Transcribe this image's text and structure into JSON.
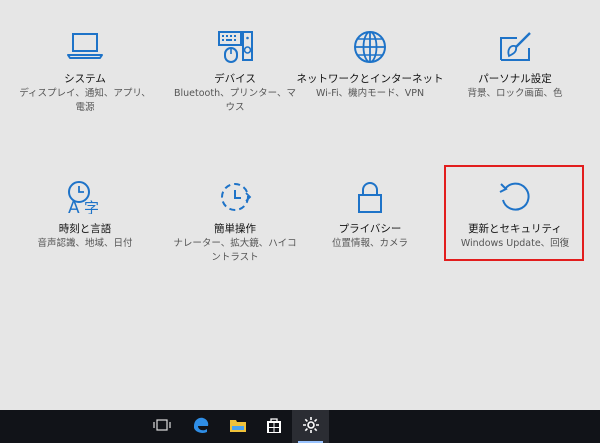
{
  "window": {
    "title": "設定"
  },
  "colors": {
    "accent": "#1e73c8",
    "highlight_border": "#e21d1d",
    "background": "#e6e6e6",
    "taskbar": "#111318"
  },
  "settings_tiles": [
    {
      "id": "system",
      "icon": "laptop-icon",
      "title": "システム",
      "subtitle_lines": [
        "ディスプレイ、通知、アプリ、",
        "電源"
      ]
    },
    {
      "id": "devices",
      "icon": "devices-icon",
      "title": "デバイス",
      "subtitle_lines": [
        "Bluetooth、プリンター、マ",
        "ウス"
      ]
    },
    {
      "id": "network",
      "icon": "globe-icon",
      "title": "ネットワークとインターネット",
      "subtitle_lines": [
        "Wi-Fi、機内モード、VPN"
      ]
    },
    {
      "id": "personalization",
      "icon": "paintbrush-icon",
      "title": "パーソナル設定",
      "subtitle_lines": [
        "背景、ロック画面、色"
      ]
    },
    {
      "id": "time_language",
      "icon": "time-language-icon",
      "title": "時刻と言語",
      "subtitle_lines": [
        "音声認識、地域、日付"
      ]
    },
    {
      "id": "ease_of_access",
      "icon": "ease-of-access-icon",
      "title": "簡単操作",
      "subtitle_lines": [
        "ナレーター、拡大鏡、ハイコ",
        "ントラスト"
      ]
    },
    {
      "id": "privacy",
      "icon": "lock-icon",
      "title": "プライバシー",
      "subtitle_lines": [
        "位置情報、カメラ"
      ]
    },
    {
      "id": "update_security",
      "icon": "refresh-icon",
      "title": "更新とセキュリティ",
      "subtitle_lines": [
        "Windows Update、回復"
      ]
    }
  ],
  "taskbar": {
    "icons": [
      "task-view-icon",
      "edge-icon",
      "file-explorer-icon",
      "store-icon",
      "settings-gear-icon"
    ],
    "active": "settings-gear-icon"
  }
}
